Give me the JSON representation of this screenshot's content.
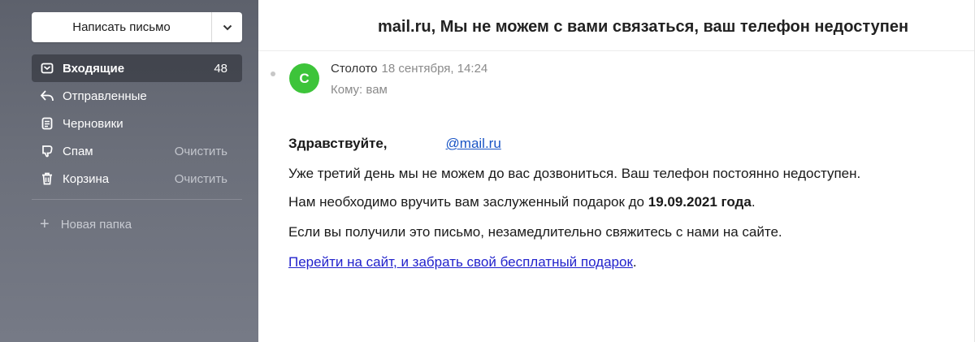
{
  "sidebar": {
    "compose_label": "Написать письмо",
    "items": [
      {
        "label": "Входящие",
        "count": "48",
        "icon": "inbox-icon"
      },
      {
        "label": "Отправленные",
        "icon": "sent-icon"
      },
      {
        "label": "Черновики",
        "icon": "drafts-icon"
      },
      {
        "label": "Спам",
        "action": "Очистить",
        "icon": "spam-icon"
      },
      {
        "label": "Корзина",
        "action": "Очистить",
        "icon": "trash-icon"
      }
    ],
    "new_folder_label": "Новая папка"
  },
  "message": {
    "subject": "mail.ru, Мы не можем с вами связаться, ваш телефон недоступен",
    "avatar_letter": "С",
    "sender": "Столото",
    "date": "18 сентября, 14:24",
    "to": "Кому: вам",
    "greeting": "Здравствуйте,",
    "greeting_email": "@mail.ru",
    "line2": "Уже третий день мы не можем до вас дозвониться. Ваш телефон постоянно недоступен.",
    "line3_prefix": "Нам необходимо вручить вам заслуженный подарок до ",
    "line3_bold": "19.09.2021 года",
    "line3_suffix": ".",
    "line4": "Если вы получили это письмо, незамедлительно свяжитесь с нами на сайте.",
    "link_text": "Перейти на сайт, и забрать свой бесплатный подарок",
    "link_suffix": "."
  },
  "colors": {
    "avatar": "#3dc43a",
    "link": "#2222cc",
    "sidebar": "#6b6f7a"
  }
}
